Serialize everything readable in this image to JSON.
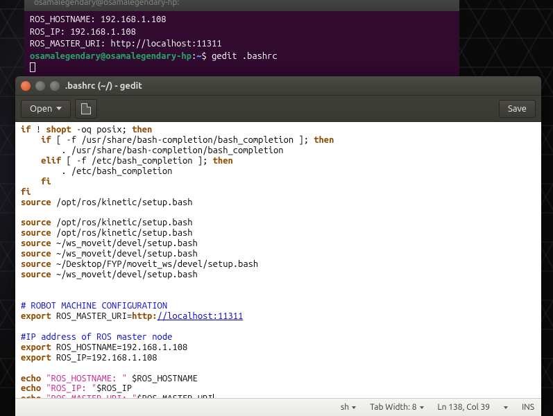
{
  "terminal": {
    "title": "osamalegendary@osamalegendary-hp:",
    "line1_label": "ROS_HOSTNAME:  ",
    "line1_value": "192.168.1.108",
    "line2_label": "ROS_IP: ",
    "line2_value": "192.168.1.108",
    "line3_label": "ROS_MASTER_URI: ",
    "line3_value": "http://localhost:11311",
    "prompt_user": "osamalegendary@osamalegendary-hp",
    "prompt_sep": ":",
    "prompt_path": "~",
    "prompt_end": "$ ",
    "command": "gedit .bashrc"
  },
  "gedit": {
    "window_title": ".bashrc (~/) - gedit",
    "toolbar": {
      "open": "Open",
      "save": "Save"
    },
    "statusbar": {
      "lang": "sh",
      "tabwidth": "Tab Width: 8",
      "position": "Ln 138, Col 39",
      "insert_mode": "INS"
    },
    "code": {
      "l01a": "if",
      "l01b": " ! ",
      "l01c": "shopt",
      "l01d": " -oq posix; ",
      "l01e": "then",
      "l02a": "    if",
      "l02b": " [ -f /usr/share/bash-completion/bash_completion ]; ",
      "l02c": "then",
      "l03": "        . /usr/share/bash-completion/bash_completion",
      "l04a": "    elif",
      "l04b": " [ -f /etc/bash_completion ]; ",
      "l04c": "then",
      "l05": "        . /etc/bash_completion",
      "l06": "    fi",
      "l07": "fi",
      "l08a": "source",
      "l08b": " /opt/ros/kinetic/setup.bash",
      "l09": "",
      "l10a": "source",
      "l10b": " /opt/ros/kinetic/setup.bash",
      "l11a": "source",
      "l11b": " /opt/ros/kinetic/setup.bash",
      "l12a": "source",
      "l12b": " ~/ws_moveit/devel/setup.bash",
      "l13a": "source",
      "l13b": " ~/ws_moveit/devel/setup.bash",
      "l14a": "source",
      "l14b": " ~/Desktop/FYP/moveit_ws/devel/setup.bash",
      "l15a": "source",
      "l15b": " ~/ws_moveit/devel/setup.bash",
      "l16": "",
      "l17": "",
      "l18": "# ROBOT MACHINE CONFIGURATION",
      "l19a": "export",
      "l19b": " ROS_MASTER_URI=",
      "l19c": "http:",
      "l19d": "//localhost:11311",
      "l20": "",
      "l21": "#IP address of ROS master node",
      "l22a": "export",
      "l22b": " ROS_HOSTNAME=192.168.1.108",
      "l23a": "export",
      "l23b": " ROS_IP=192.168.1.108",
      "l24": "",
      "l25a": "echo",
      "l25b": " ",
      "l25c": "\"ROS_HOSTNAME: \"",
      "l25d": " $ROS_HOSTNAME",
      "l26a": "echo",
      "l26b": " ",
      "l26c": "\"ROS_IP: \"",
      "l26d": "$ROS_IP",
      "l27a": "echo",
      "l27b": " ",
      "l27c": "\"ROS_MASTER_URI: \"",
      "l27d": "$ROS_MASTER_URI"
    }
  }
}
